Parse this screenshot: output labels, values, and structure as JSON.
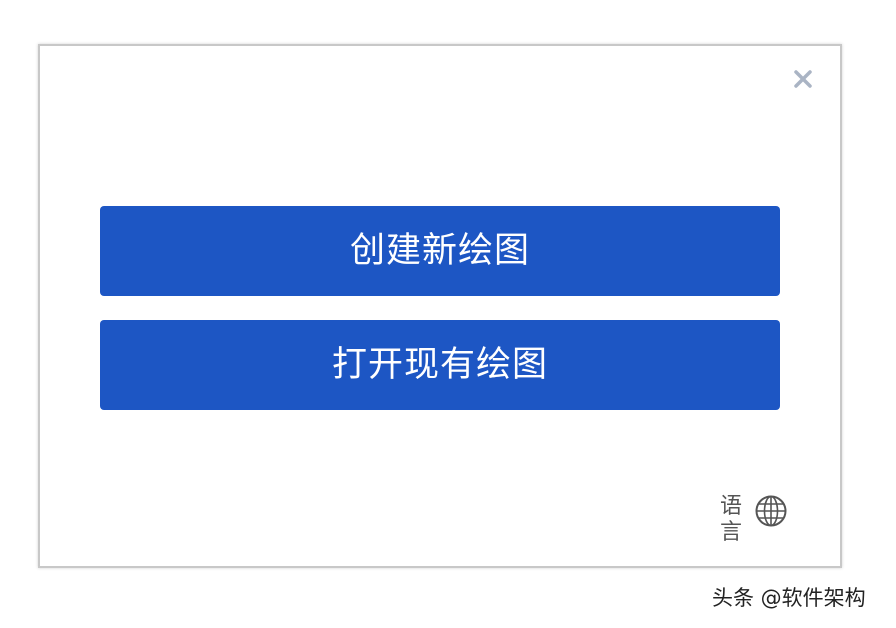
{
  "dialog": {
    "close_label": "×",
    "create_new_label": "创建新绘图",
    "open_existing_label": "打开现有绘图",
    "language_label": "语言"
  },
  "watermark": {
    "text": "头条 @软件架构"
  },
  "colors": {
    "button_bg": "#1d56c4",
    "button_text": "#ffffff",
    "close_icon": "#aab4c4",
    "dialog_border": "#c8c8c8"
  },
  "icons": {
    "close": "close-icon",
    "language": "globe-icon"
  }
}
